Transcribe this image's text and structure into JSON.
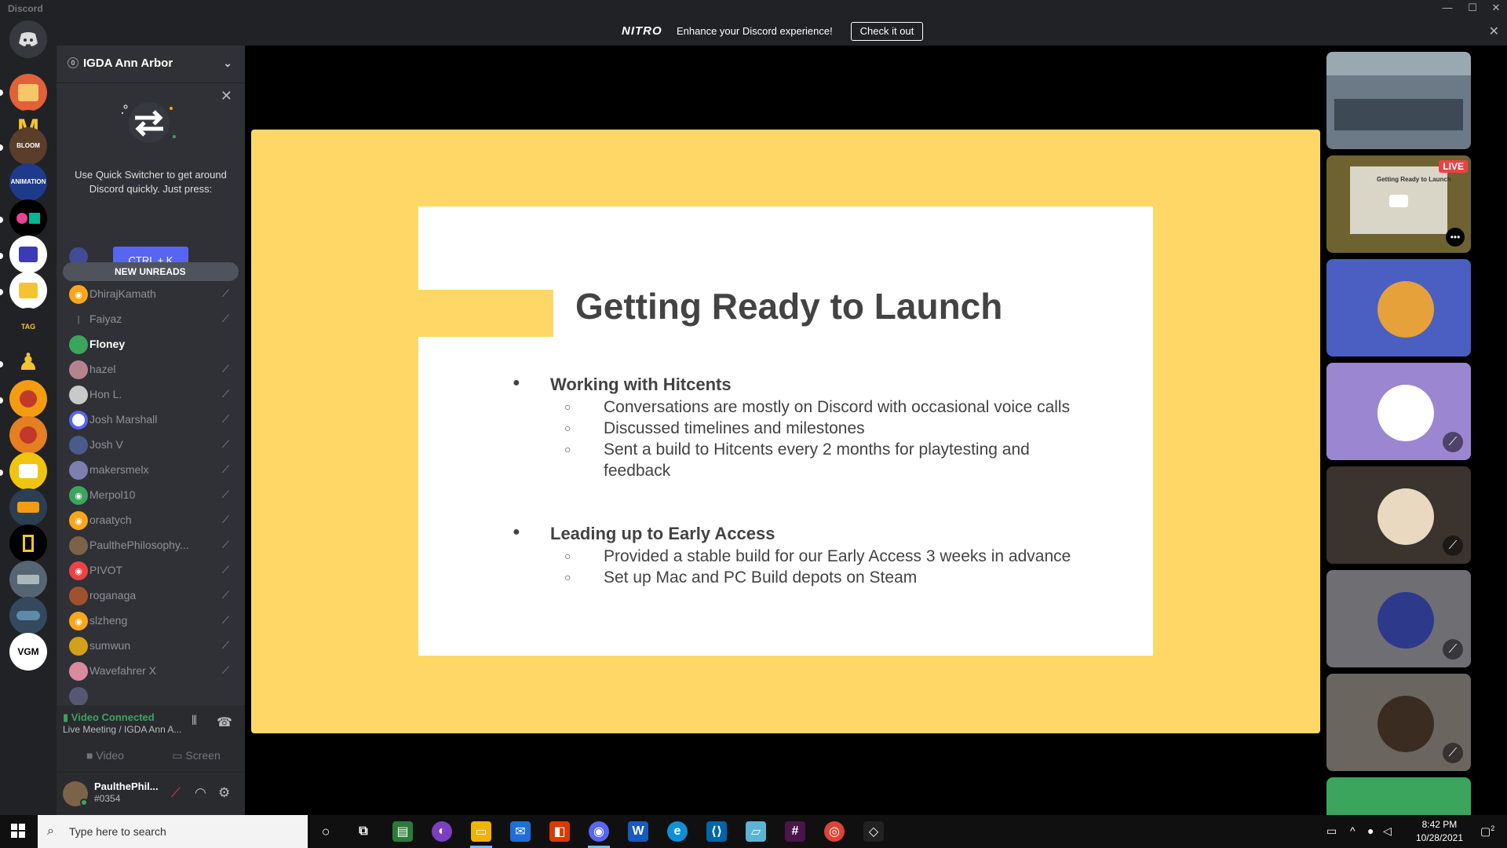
{
  "window": {
    "app_name": "Discord",
    "minimize": "—",
    "maximize": "☐",
    "close": "✕"
  },
  "nitro_banner": {
    "logo": "NITRO",
    "message": "Enhance your Discord experience!",
    "cta": "Check it out",
    "close": "✕"
  },
  "server": {
    "badge": "0",
    "name": "IGDA Ann Arbor"
  },
  "quick_switcher": {
    "text": "Use Quick Switcher to get around Discord quickly. Just press:",
    "shortcut": "CTRL + K"
  },
  "members": {
    "new_unreads_label": "NEW UNREADS",
    "list": [
      {
        "name": "DhirajKamath",
        "color": "#faa61a",
        "highlight": false
      },
      {
        "name": "Faiyaz",
        "color": "#2f3136",
        "highlight": false
      },
      {
        "name": "Floney",
        "color": "#3ba55d",
        "highlight": true
      },
      {
        "name": "hazel",
        "color": "#b5838d",
        "highlight": false
      },
      {
        "name": "Hon L.",
        "color": "#c9c9c9",
        "highlight": false
      },
      {
        "name": "Josh Marshall",
        "color": "#5865f2",
        "highlight": false
      },
      {
        "name": "Josh V",
        "color": "#4a5a8a",
        "highlight": false
      },
      {
        "name": "makersmelx",
        "color": "#7d7fb0",
        "highlight": false
      },
      {
        "name": "Merpol10",
        "color": "#3ba55d",
        "highlight": false
      },
      {
        "name": "oraatych",
        "color": "#faa61a",
        "highlight": false
      },
      {
        "name": "PaulthePhilosophy...",
        "color": "#7a6348",
        "highlight": false
      },
      {
        "name": "PIVOT",
        "color": "#ed4245",
        "highlight": false
      },
      {
        "name": "roganaga",
        "color": "#a0522d",
        "highlight": false
      },
      {
        "name": "slzheng",
        "color": "#faa61a",
        "highlight": false
      },
      {
        "name": "sumwun",
        "color": "#d4a017",
        "highlight": false
      },
      {
        "name": "Wavefahrer X",
        "color": "#d98aa0",
        "highlight": false
      }
    ]
  },
  "voice": {
    "status": "Video Connected",
    "channel": "Live Meeting / IGDA Ann A...",
    "video_label": "Video",
    "screen_label": "Screen"
  },
  "user": {
    "name": "PaulthePhil...",
    "tag": "#0354"
  },
  "slide": {
    "title": "Getting Ready to Launch",
    "sections": [
      {
        "heading": "Working with Hitcents",
        "items": [
          "Conversations are mostly on Discord with occasional voice calls",
          "Discussed timelines and milestones",
          "Sent a build to Hitcents every 2 months for playtesting and feedback"
        ]
      },
      {
        "heading": "Leading up to Early Access",
        "items": [
          "Provided a stable build for our Early Access 3 weeks in advance",
          "Set up Mac and PC Build depots on Steam"
        ]
      }
    ]
  },
  "tiles": {
    "live_label": "LIVE",
    "mini_slide_title": "Getting Ready to Launch"
  },
  "taskbar": {
    "search_placeholder": "Type here to search",
    "time": "8:42 PM",
    "date": "10/28/2021",
    "notif_count": "2"
  },
  "colors": {
    "blurple": "#5865f2",
    "green": "#3ba55d",
    "slide_yellow": "#fed766"
  }
}
